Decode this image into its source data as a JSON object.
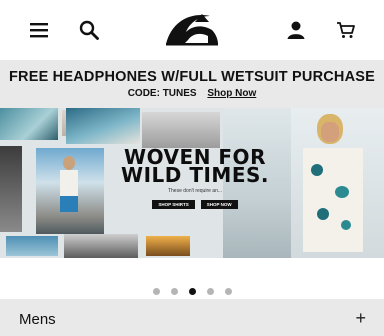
{
  "header": {
    "icons": [
      "hamburger-menu-icon",
      "search-icon",
      "quiksilver-logo",
      "account-icon",
      "cart-icon"
    ]
  },
  "promo": {
    "headline": "FREE HEADPHONES W/FULL WETSUIT PURCHASE",
    "code_text": "CODE: TUNES",
    "link_label": "Shop Now",
    "bg_color": "#e9e9e9"
  },
  "hero": {
    "headline_line1": "WOVEN FOR",
    "headline_line2": "WILD TIMES.",
    "tagline": "These don't require an...",
    "cta_1": "SHOP SHIRTS",
    "cta_2": "SHOP NOW"
  },
  "carousel": {
    "slide_count": 5,
    "active_index": 2
  },
  "accordion": {
    "label": "Mens",
    "toggle": "+"
  }
}
